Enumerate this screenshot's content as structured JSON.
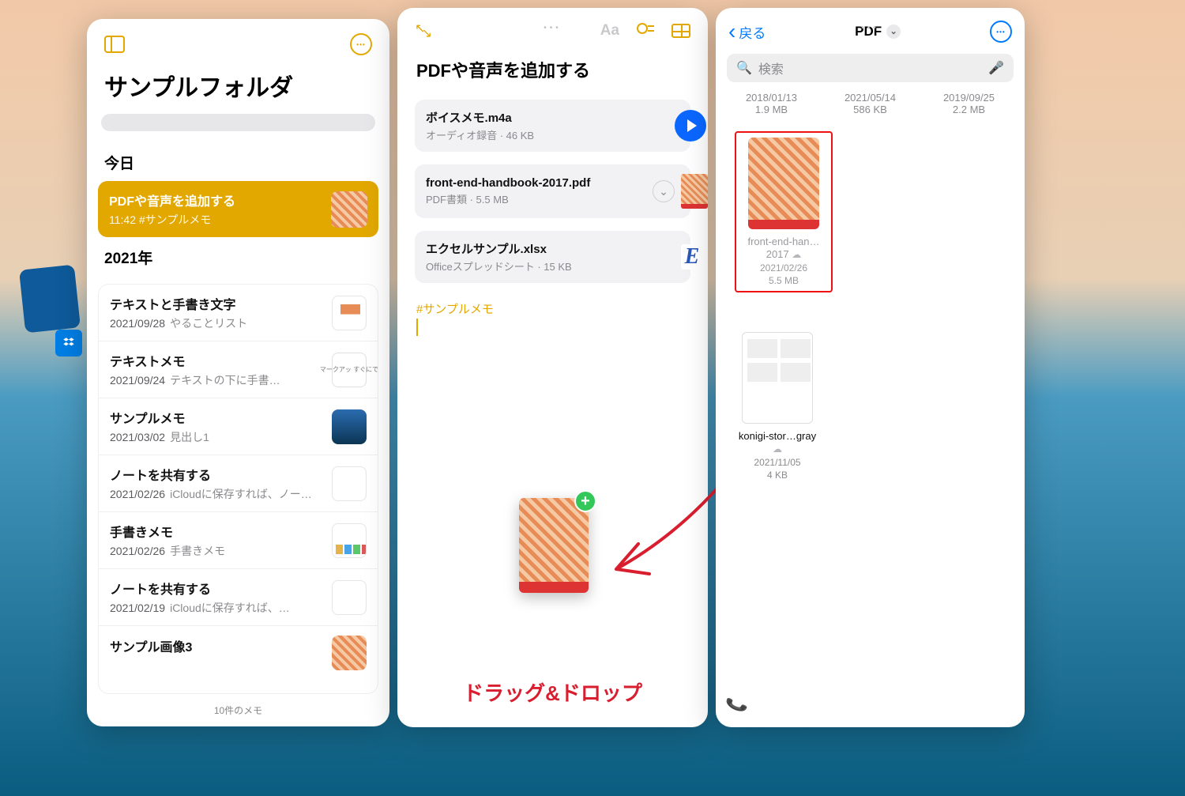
{
  "left": {
    "folderTitle": "サンプルフォルダ",
    "todayHeader": "今日",
    "selected": {
      "title": "PDFや音声を追加する",
      "time": "11:42",
      "tag": "#サンプルメモ"
    },
    "yearHeader": "2021年",
    "notes": [
      {
        "title": "テキストと手書き文字",
        "date": "2021/09/28",
        "sub": "やることリスト"
      },
      {
        "title": "テキストメモ",
        "date": "2021/09/24",
        "sub": "テキストの下に手書…"
      },
      {
        "title": "サンプルメモ",
        "date": "2021/03/02",
        "sub": "見出し1"
      },
      {
        "title": "ノートを共有する",
        "date": "2021/02/26",
        "sub": "iCloudに保存すれば、ノートだ…"
      },
      {
        "title": "手書きメモ",
        "date": "2021/02/26",
        "sub": "手書きメモ"
      },
      {
        "title": "ノートを共有する",
        "date": "2021/02/19",
        "sub": "iCloudに保存すれば、…"
      },
      {
        "title": "サンプル画像3",
        "date": "",
        "sub": ""
      }
    ],
    "footerCount": "10件のメモ"
  },
  "mid": {
    "title": "PDFや音声を追加する",
    "aa": "Aa",
    "attachments": [
      {
        "title": "ボイスメモ.m4a",
        "sub": "オーディオ録音 · 46 KB"
      },
      {
        "title": "front-end-handbook-2017.pdf",
        "sub": "PDF書類 · 5.5 MB"
      },
      {
        "title": "エクセルサンプル.xlsx",
        "sub": "Officeスプレッドシート · 15 KB"
      }
    ],
    "hashtag": "#サンプルメモ",
    "excelGlyph": "E",
    "caption": "ドラッグ&ドロップ"
  },
  "right": {
    "back": "戻る",
    "title": "PDF",
    "searchPlaceholder": "検索",
    "topRow": [
      {
        "date": "2018/01/13",
        "size": "1.9 MB"
      },
      {
        "date": "2021/05/14",
        "size": "586 KB"
      },
      {
        "date": "2019/09/25",
        "size": "2.2 MB"
      }
    ],
    "files": [
      {
        "name": "front-end-han…2017",
        "date": "2021/02/26",
        "size": "5.5 MB"
      },
      {
        "name": "konigi-stor…gray",
        "date": "2021/11/05",
        "size": "4 KB"
      }
    ]
  },
  "thumbText": "マークアッ\nすぐにで"
}
